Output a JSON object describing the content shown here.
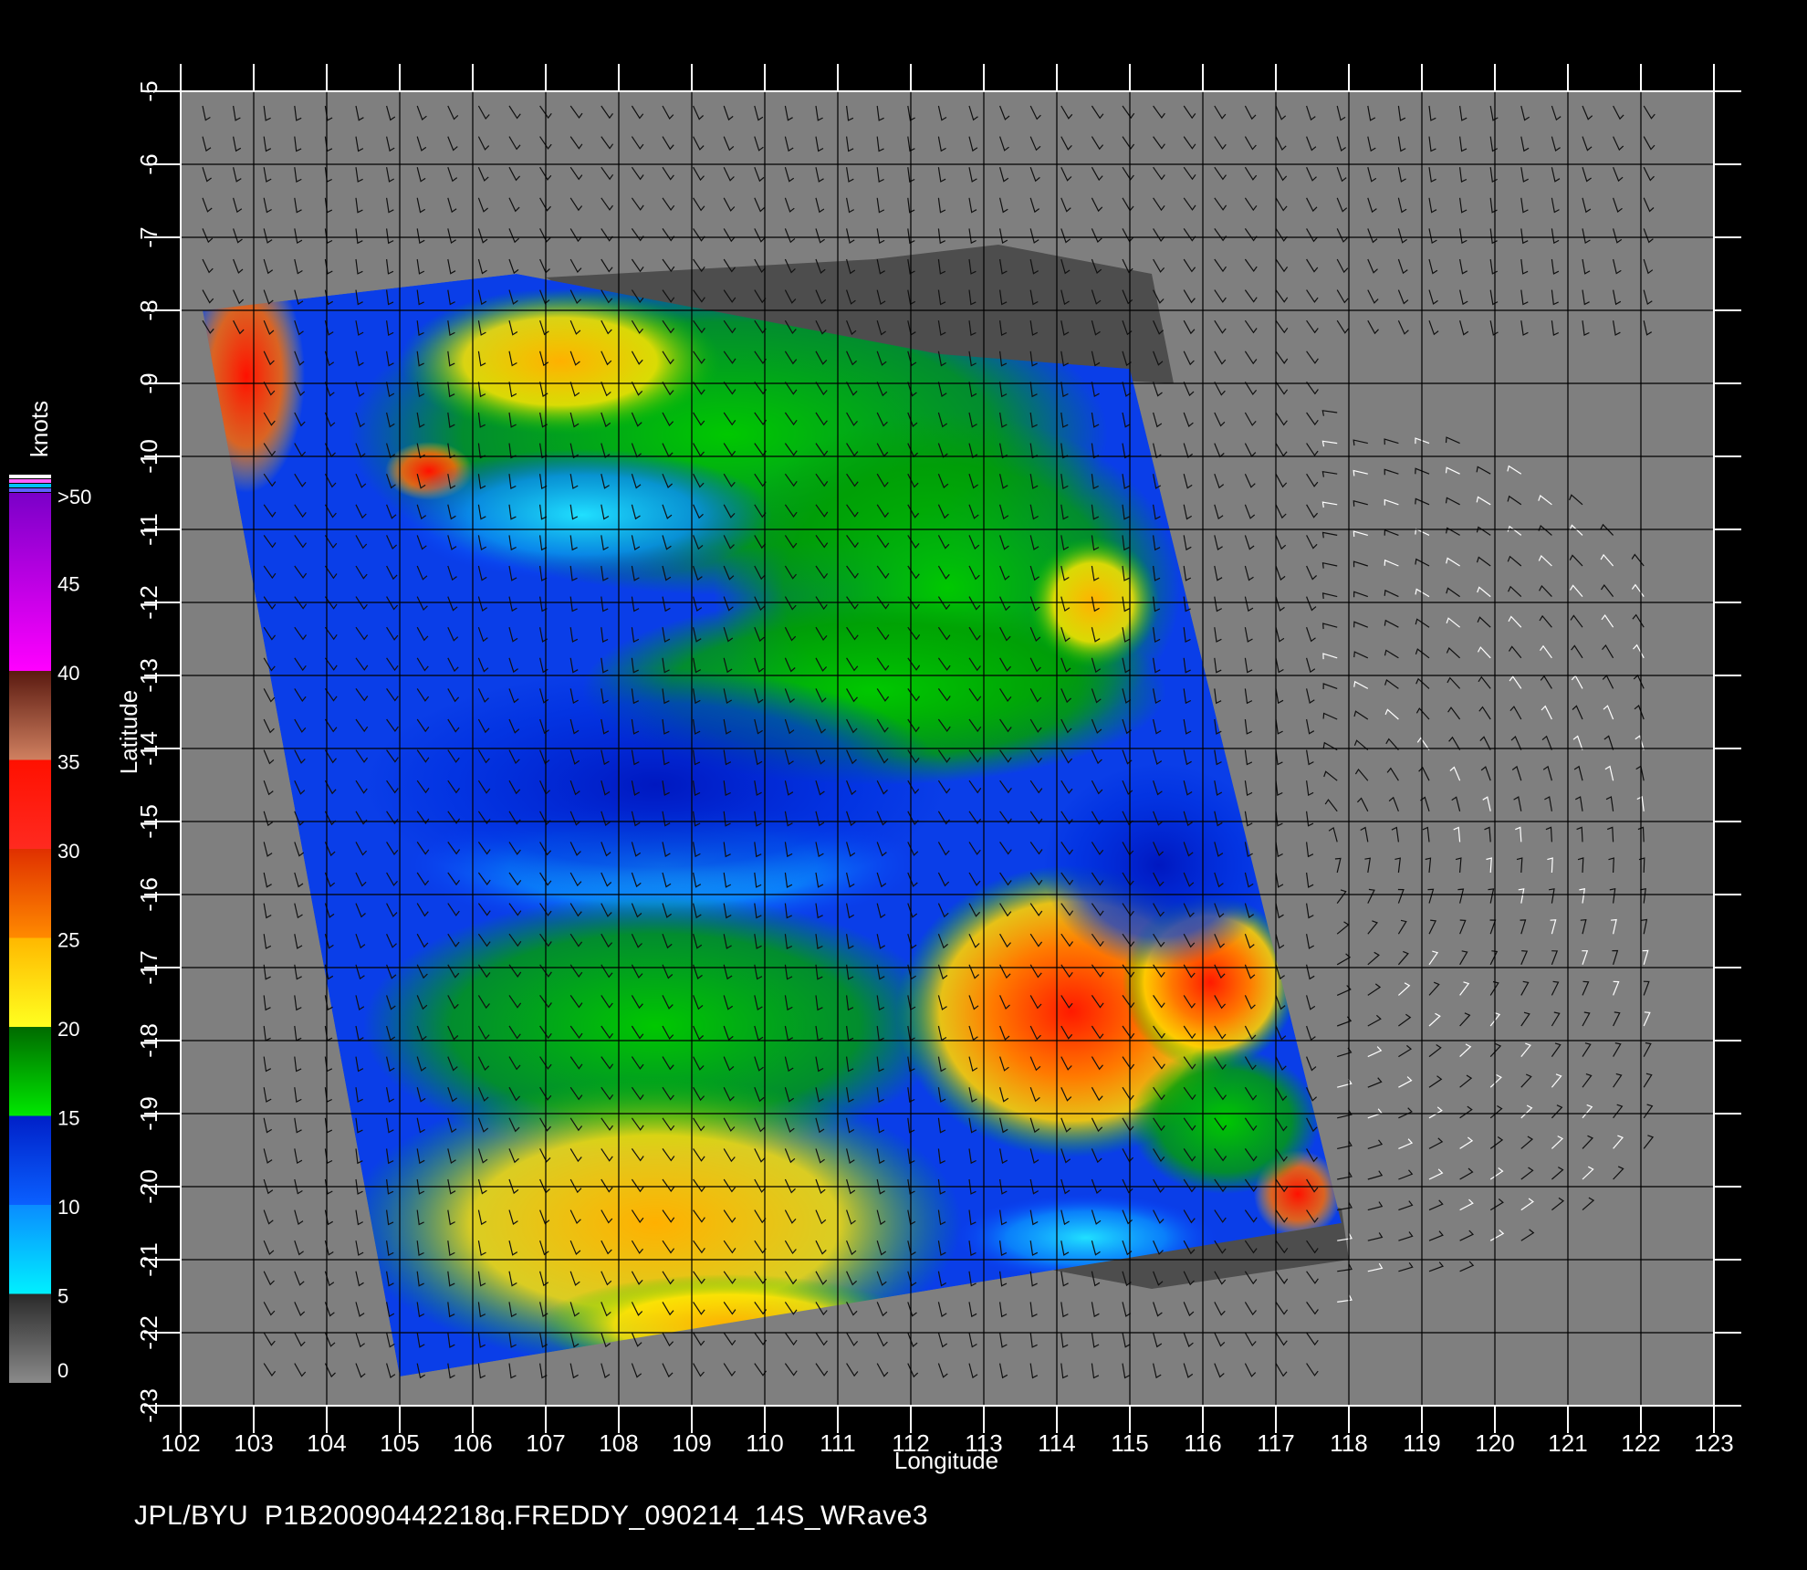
{
  "colors": {
    "background": "#000000",
    "plot_background": "#7f7f7f",
    "grid": "#000000",
    "frame_ticks": "#ffffff",
    "land_mask": "#4d4d4d"
  },
  "map": {
    "x_axis": {
      "label": "Longitude",
      "range": [
        102,
        123
      ],
      "ticks": [
        "102",
        "103",
        "104",
        "105",
        "106",
        "107",
        "108",
        "109",
        "110",
        "111",
        "112",
        "113",
        "114",
        "115",
        "116",
        "117",
        "118",
        "119",
        "120",
        "121",
        "122",
        "123"
      ]
    },
    "y_axis": {
      "label": "Latitude",
      "range": [
        -23,
        -5
      ],
      "ticks": [
        "-5",
        "-6",
        "-7",
        "-8",
        "-9",
        "-10",
        "-11",
        "-12",
        "-13",
        "-14",
        "-15",
        "-16",
        "-17",
        "-18",
        "-19",
        "-20",
        "-21",
        "-22",
        "-23"
      ]
    },
    "swath_corners_lonlat": [
      [
        102.3,
        -8.0
      ],
      [
        106.6,
        -7.5
      ],
      [
        112.4,
        -8.6
      ],
      [
        115.0,
        -8.8
      ],
      [
        117.9,
        -20.5
      ],
      [
        105.0,
        -22.6
      ]
    ],
    "swath_speed_knots": "wind-speed shading of the scatterometer swath",
    "wind_barbs": "wind barbs plotted across the swath and surrounding ocean"
  },
  "colorbar": {
    "title": "knots",
    "labels": [
      ">50",
      "45",
      "40",
      "35",
      "30",
      "25",
      "20",
      "15",
      "10",
      "5",
      "0"
    ],
    "stops": [
      {
        "from": 0,
        "to": 5,
        "top": "#2a2a2a",
        "bottom": "#8a8a8a"
      },
      {
        "from": 5,
        "to": 10,
        "top": "#0a8cff",
        "bottom": "#00f0ff"
      },
      {
        "from": 10,
        "to": 15,
        "top": "#0020c8",
        "bottom": "#0a60ff"
      },
      {
        "from": 15,
        "to": 20,
        "top": "#006a00",
        "bottom": "#00e800"
      },
      {
        "from": 20,
        "to": 25,
        "top": "#ffb800",
        "bottom": "#ffff20"
      },
      {
        "from": 25,
        "to": 30,
        "top": "#e03000",
        "bottom": "#ff8a00"
      },
      {
        "from": 30,
        "to": 35,
        "top": "#ff1000",
        "bottom": "#ff2a20"
      },
      {
        "from": 35,
        "to": 40,
        "top": "#5a1a10",
        "bottom": "#d08060"
      },
      {
        "from": 40,
        "to": 50,
        "top": "#7a00c8",
        "bottom": "#ff00ff"
      }
    ]
  },
  "footer": {
    "text": "JPL/BYU  P1B20090442218q.FREDDY_090214_14S_WRave3"
  }
}
